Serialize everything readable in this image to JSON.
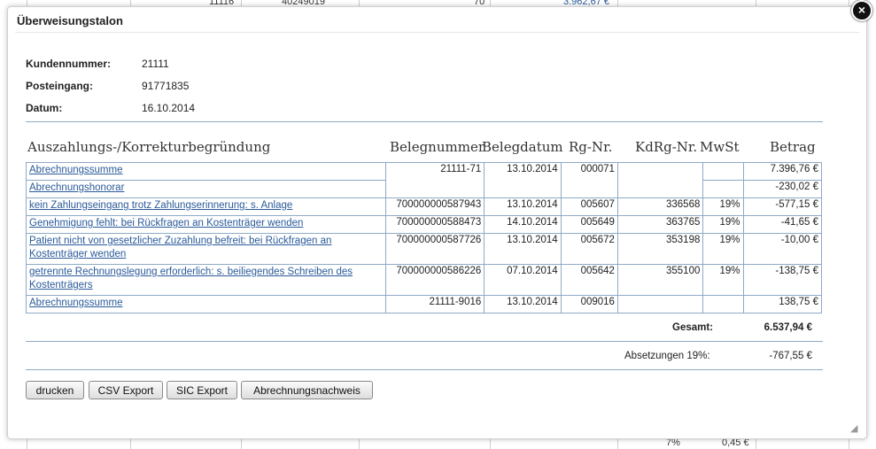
{
  "background": {
    "row_fragment": [
      "11116",
      "40249019",
      "70",
      "3.962,67 €"
    ],
    "footer_fragment": [
      "7%",
      "0,45 €"
    ]
  },
  "dialog": {
    "title": "Überweisungstalon",
    "close_label": "×"
  },
  "info": {
    "kundennummer_label": "Kundennummer:",
    "kundennummer": "21111",
    "posteingang_label": "Posteingang:",
    "posteingang": "91771835",
    "datum_label": "Datum:",
    "datum": "16.10.2014"
  },
  "table": {
    "headers": {
      "reason": "Auszahlungs-/Korrekturbegründung",
      "belegnummer": "Belegnummer",
      "belegdatum": "Belegdatum",
      "rgnr": "Rg-Nr.",
      "kdrgnr": "KdRg-Nr.",
      "mwst": "MwSt",
      "betrag": "Betrag"
    },
    "rows": [
      {
        "reason": "Abrechnungssumme",
        "beleg": "21111-71",
        "datum": "13.10.2014",
        "rg": "000071",
        "kd": "",
        "mw": "",
        "betrag": "7.396,76 €"
      },
      {
        "reason": "Abrechnungshonorar",
        "beleg": "",
        "datum": "",
        "rg": "",
        "kd": "",
        "mw": "",
        "betrag": "-230,02 €"
      },
      {
        "reason": "kein Zahlungseingang trotz Zahlungserinnerung: s. Anlage",
        "beleg": "700000000587943",
        "datum": "13.10.2014",
        "rg": "005607",
        "kd": "336568",
        "mw": "19%",
        "betrag": "-577,15 €"
      },
      {
        "reason": "Genehmigung fehlt: bei Rückfragen an Kostenträger wenden",
        "beleg": "700000000588473",
        "datum": "14.10.2014",
        "rg": "005649",
        "kd": "363765",
        "mw": "19%",
        "betrag": "-41,65 €"
      },
      {
        "reason": "Patient nicht von gesetzlicher Zuzahlung befreit: bei Rückfragen an Kostenträger wenden",
        "beleg": "700000000587726",
        "datum": "13.10.2014",
        "rg": "005672",
        "kd": "353198",
        "mw": "19%",
        "betrag": "-10,00 €"
      },
      {
        "reason": "getrennte Rechnungslegung erforderlich: s. beiliegendes Schreiben des Kostenträgers",
        "beleg": "700000000586226",
        "datum": "07.10.2014",
        "rg": "005642",
        "kd": "355100",
        "mw": "19%",
        "betrag": "-138,75 €"
      },
      {
        "reason": "Abrechnungssumme",
        "beleg": "21111-9016",
        "datum": "13.10.2014",
        "rg": "009016",
        "kd": "",
        "mw": "",
        "betrag": "138,75 €"
      }
    ]
  },
  "totals": {
    "gesamt_label": "Gesamt:",
    "gesamt": "6.537,94 €",
    "absetzungen_label": "Absetzungen 19%:",
    "absetzungen": "-767,55 €"
  },
  "buttons": {
    "drucken": "drucken",
    "csv": "CSV Export",
    "sic": "SIC Export",
    "nachweis": "Abrechnungsnachweis"
  }
}
